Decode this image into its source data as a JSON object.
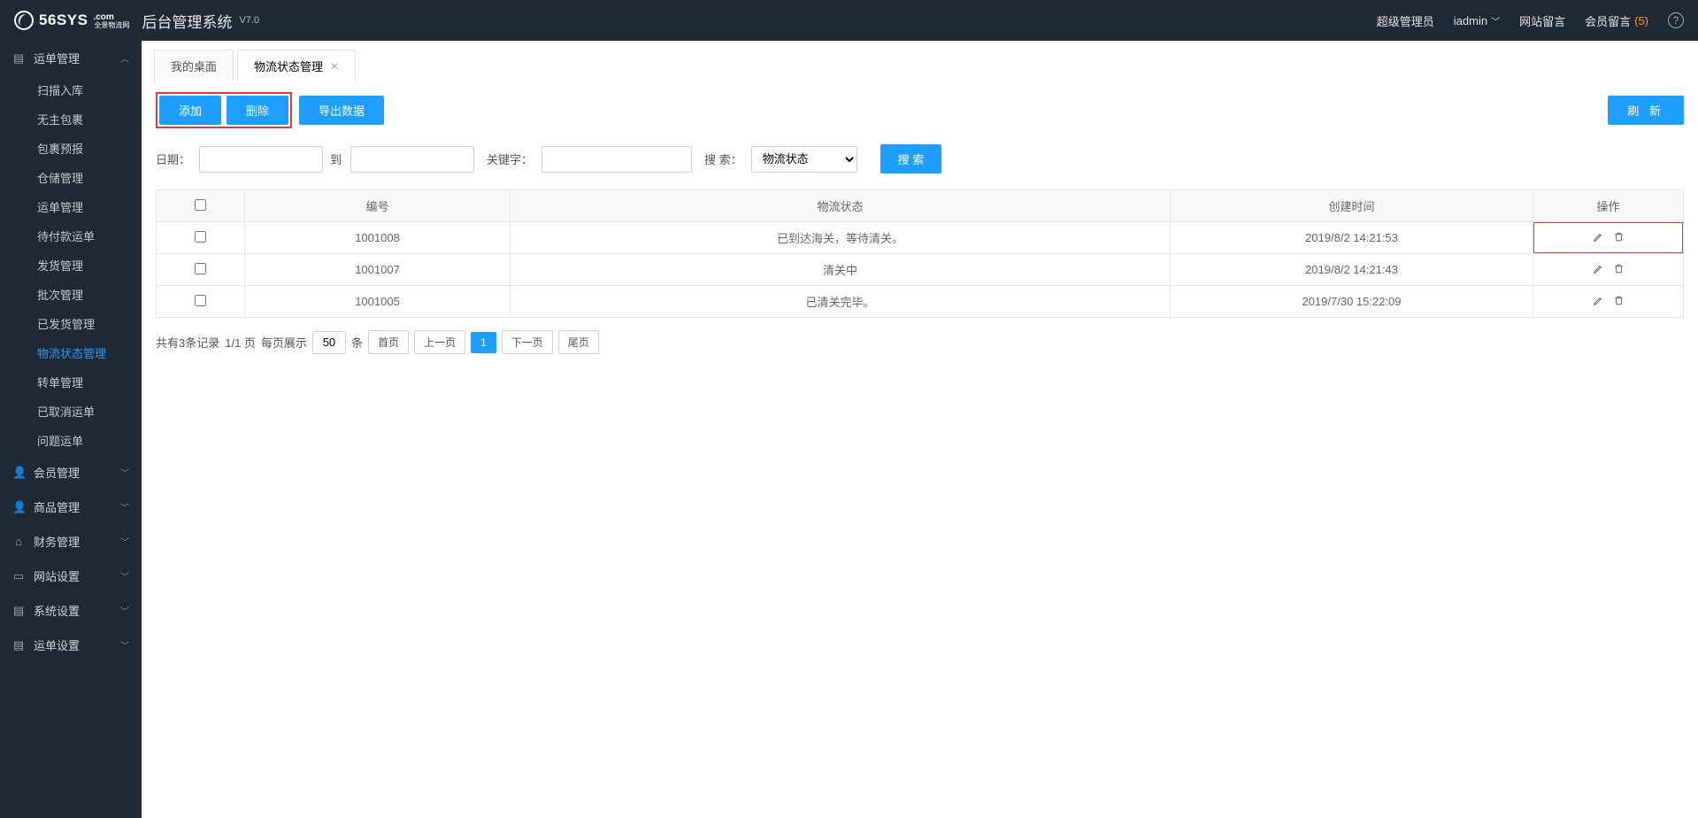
{
  "header": {
    "logo": "56SYS",
    "logo_suffix": ".com",
    "logo_sub": "全景物流网",
    "title": "后台管理系统",
    "version": "V7.0",
    "role": "超级管理员",
    "user": "iadmin",
    "site_msg": "网站留言",
    "member_msg": "会员留言",
    "msg_count": "(5)"
  },
  "sidebar": {
    "groups": [
      {
        "icon": "▤",
        "label": "运单管理",
        "expanded": true,
        "arrow": "︿",
        "items": [
          {
            "label": "扫描入库"
          },
          {
            "label": "无主包裹"
          },
          {
            "label": "包裹预报"
          },
          {
            "label": "仓储管理"
          },
          {
            "label": "运单管理"
          },
          {
            "label": "待付款运单"
          },
          {
            "label": "发货管理"
          },
          {
            "label": "批次管理"
          },
          {
            "label": "已发货管理"
          },
          {
            "label": "物流状态管理",
            "active": true
          },
          {
            "label": "转单管理"
          },
          {
            "label": "已取消运单"
          },
          {
            "label": "问题运单"
          }
        ]
      },
      {
        "icon": "👤",
        "label": "会员管理",
        "arrow": "﹀"
      },
      {
        "icon": "👤",
        "label": "商品管理",
        "arrow": "﹀"
      },
      {
        "icon": "⌂",
        "label": "财务管理",
        "arrow": "﹀"
      },
      {
        "icon": "▭",
        "label": "网站设置",
        "arrow": "﹀"
      },
      {
        "icon": "▤",
        "label": "系统设置",
        "arrow": "﹀"
      },
      {
        "icon": "▤",
        "label": "运单设置",
        "arrow": "﹀"
      }
    ]
  },
  "tabs": [
    {
      "label": "我的桌面",
      "closable": false,
      "active": false
    },
    {
      "label": "物流状态管理",
      "closable": true,
      "active": true
    }
  ],
  "toolbar": {
    "add": "添加",
    "delete": "删除",
    "export": "导出数据",
    "refresh": "刷 新"
  },
  "filters": {
    "date_label": "日期：",
    "to_label": "到",
    "keyword_label": "关键字：",
    "search_label": "搜 索：",
    "search_select": "物流状态",
    "search_button": "搜 索"
  },
  "table": {
    "headers": {
      "id": "编号",
      "status": "物流状态",
      "time": "创建时间",
      "action": "操作"
    },
    "rows": [
      {
        "id": "1001008",
        "status": "已到达海关，等待清关。",
        "time": "2019/8/2 14:21:53",
        "highlight": true
      },
      {
        "id": "1001007",
        "status": "清关中",
        "time": "2019/8/2 14:21:43"
      },
      {
        "id": "1001005",
        "status": "已清关完毕。",
        "time": "2019/7/30 15:22:09"
      }
    ]
  },
  "pagination": {
    "total_text": "共有3条记录",
    "page_text": "1/1 页",
    "per_page_label": "每页展示",
    "per_page": "50",
    "unit": "条",
    "first": "首页",
    "prev": "上一页",
    "current": "1",
    "next": "下一页",
    "last": "尾页"
  }
}
